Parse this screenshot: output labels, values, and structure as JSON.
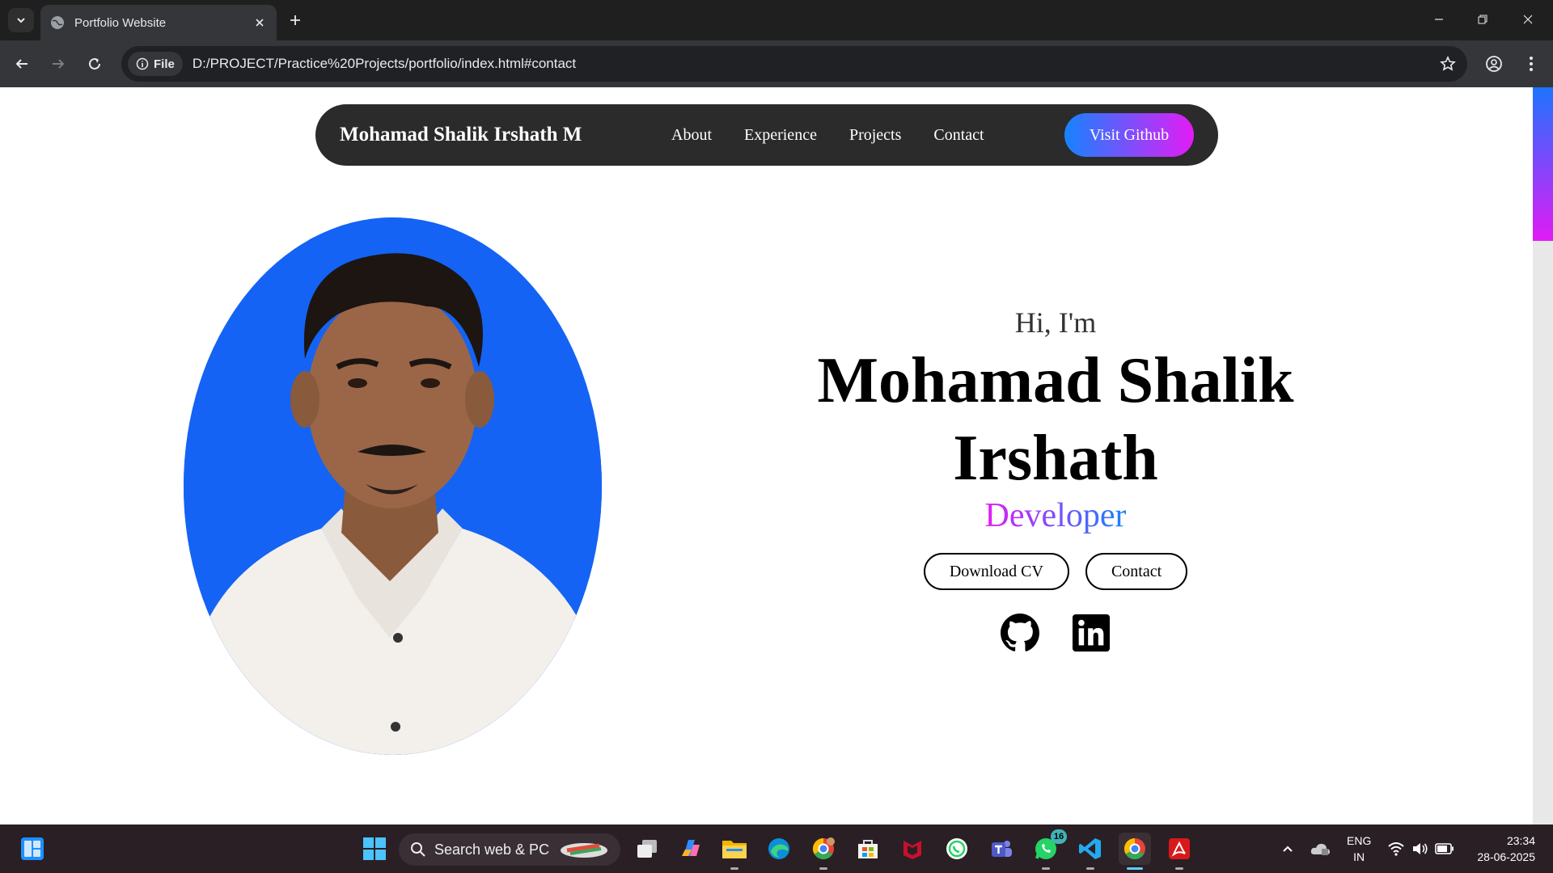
{
  "browser": {
    "tab_title": "Portfolio Website",
    "chip_label": "File",
    "url": "D:/PROJECT/Practice%20Projects/portfolio/index.html#contact"
  },
  "nav": {
    "brand": "Mohamad Shalik Irshath M",
    "links": [
      "About",
      "Experience",
      "Projects",
      "Contact"
    ],
    "github_button": "Visit Github"
  },
  "hero": {
    "greeting": "Hi, I'm",
    "name_line1": "Mohamad Shalik",
    "name_line2": "Irshath",
    "role": "Developer",
    "download_button": "Download CV",
    "contact_button": "Contact"
  },
  "colors": {
    "accent_blue": "#1683ff",
    "accent_magenta": "#e31cf5",
    "profile_bg": "#1463f5",
    "nav_bg": "#2b2b2b"
  },
  "taskbar": {
    "search_placeholder": "Search web & PC",
    "lang_line1": "ENG",
    "lang_line2": "IN",
    "time": "23:34",
    "date": "28-06-2025",
    "whatsapp_badge": "16"
  }
}
